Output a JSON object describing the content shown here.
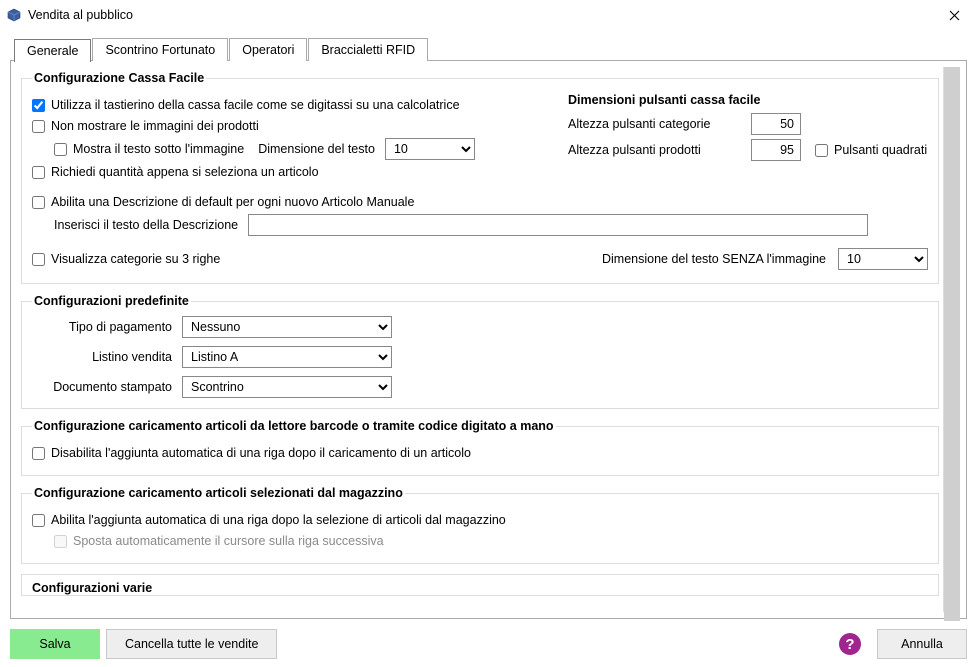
{
  "window": {
    "title": "Vendita al pubblico"
  },
  "tabs": {
    "t0": "Generale",
    "t1": "Scontrino Fortunato",
    "t2": "Operatori",
    "t3": "Braccialetti RFID"
  },
  "group_cassa": {
    "legend": "Configurazione Cassa Facile",
    "chk_calc": "Utilizza il tastierino della cassa facile come se digitassi su una calcolatrice",
    "chk_noimg": "Non mostrare le immagini dei prodotti",
    "chk_text_under": "Mostra il testo sotto l'immagine",
    "text_size_label": "Dimensione del testo",
    "text_size_value": "10",
    "chk_req_qty": "Richiedi quantità appena si seleziona un articolo",
    "chk_enable_desc": "Abilita una Descrizione di default per ogni nuovo Articolo Manuale",
    "desc_input_label": "Inserisci il testo della Descrizione",
    "desc_input_value": "",
    "chk_cat_3rows": "Visualizza categorie su 3 righe",
    "text_size_noimg_label": "Dimensione del testo SENZA l'immagine",
    "text_size_noimg_value": "10",
    "dim_legend": "Dimensioni pulsanti cassa facile",
    "dim_cat_label": "Altezza pulsanti categorie",
    "dim_cat_value": "50",
    "dim_prod_label": "Altezza pulsanti prodotti",
    "dim_prod_value": "95",
    "chk_square": "Pulsanti quadrati"
  },
  "group_predef": {
    "legend": "Configurazioni predefinite",
    "pay_label": "Tipo di pagamento",
    "pay_value": "Nessuno",
    "list_label": "Listino vendita",
    "list_value": "Listino A",
    "doc_label": "Documento stampato",
    "doc_value": "Scontrino"
  },
  "group_barcode": {
    "legend": "Configurazione caricamento articoli da lettore barcode o tramite codice digitato a mano",
    "chk_disable_auto": "Disabilita l'aggiunta automatica di una riga dopo il caricamento di un articolo"
  },
  "group_mag": {
    "legend": "Configurazione caricamento articoli selezionati dal magazzino",
    "chk_enable_auto": "Abilita l'aggiunta automatica di una riga dopo la selezione di articoli dal magazzino",
    "chk_move_cursor": "Sposta automaticamente il cursore sulla riga successiva"
  },
  "group_varie": {
    "legend": "Configurazioni varie"
  },
  "footer": {
    "save": "Salva",
    "cancel_all": "Cancella tutte le vendite",
    "annulla": "Annulla"
  }
}
